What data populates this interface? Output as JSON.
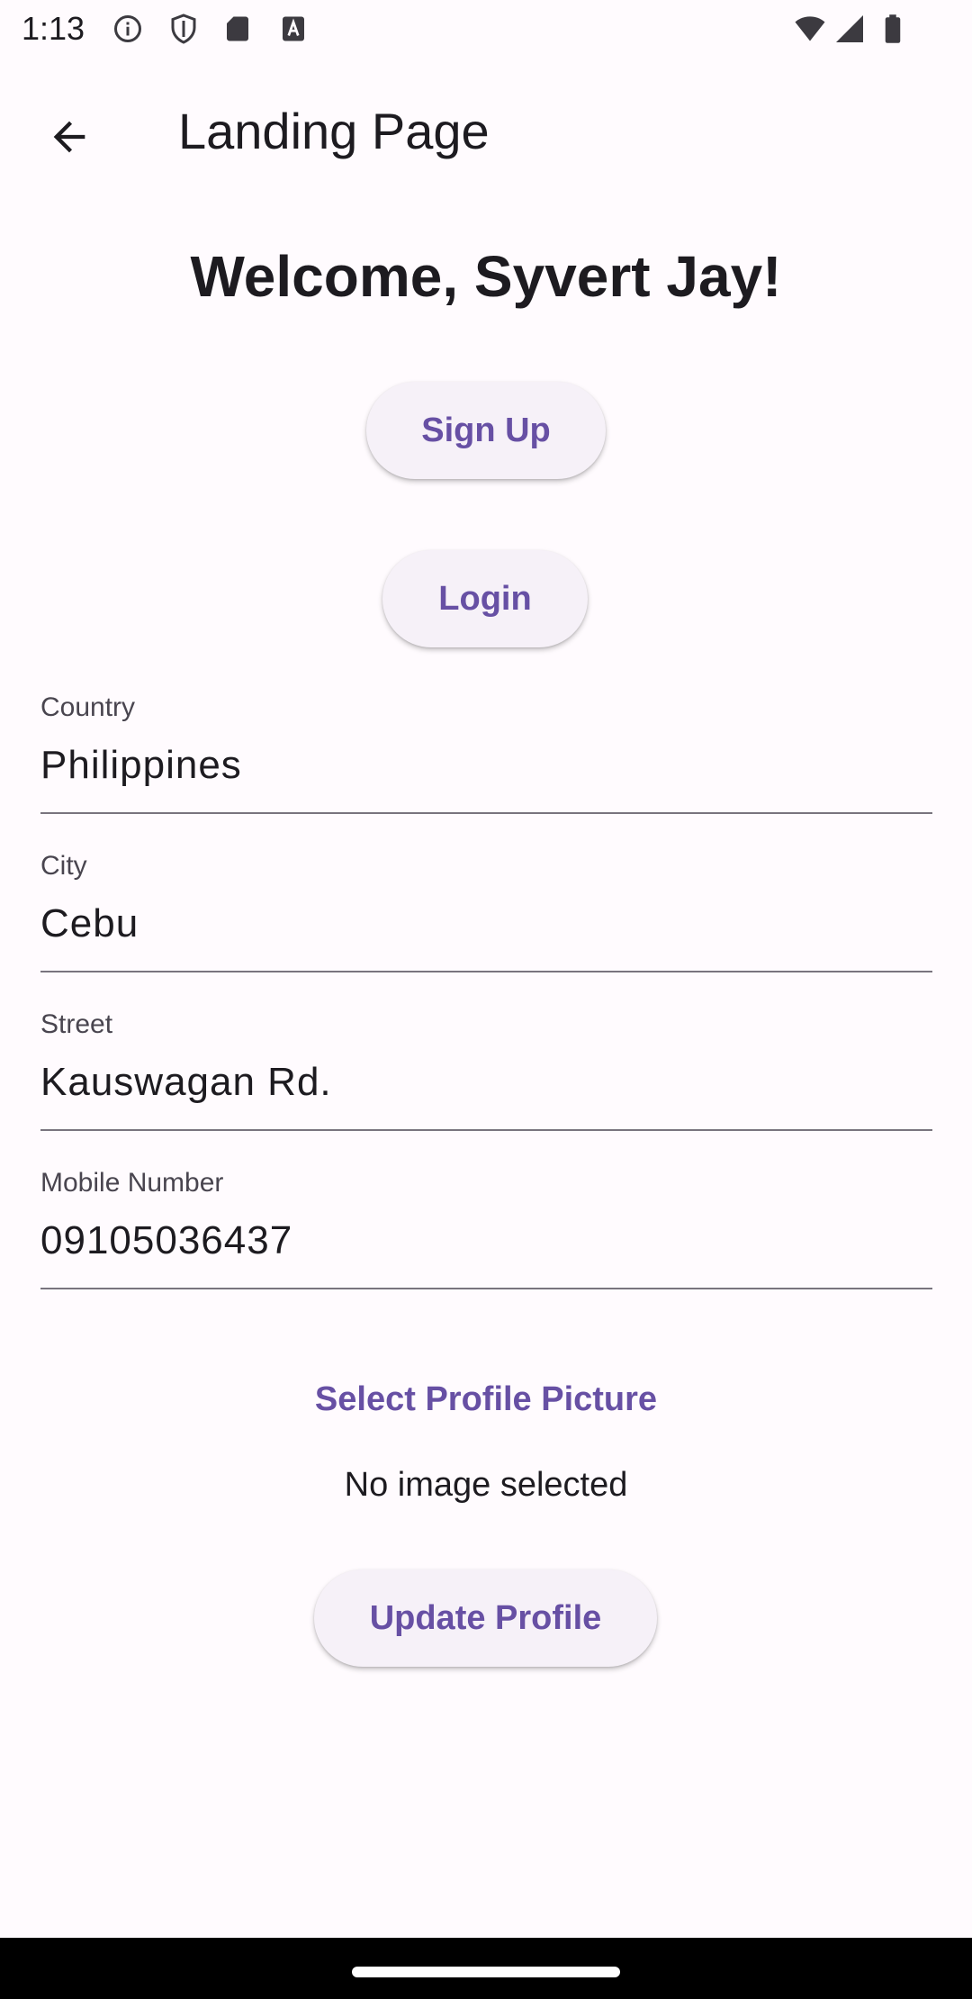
{
  "status_bar": {
    "time": "1:13",
    "icons": [
      "info-icon",
      "shield-icon",
      "sd-card-icon",
      "font-a-icon",
      "wifi-icon",
      "signal-icon",
      "battery-icon"
    ]
  },
  "app_bar": {
    "title": "Landing Page",
    "back_icon": "arrow-back-icon"
  },
  "welcome": {
    "text": "Welcome, Syvert Jay!"
  },
  "buttons": {
    "sign_up": "Sign Up",
    "login": "Login",
    "select_profile_picture": "Select Profile Picture",
    "update_profile": "Update Profile"
  },
  "fields": [
    {
      "label": "Country",
      "value": "Philippines"
    },
    {
      "label": "City",
      "value": "Cebu"
    },
    {
      "label": "Street",
      "value": "Kauswagan Rd."
    },
    {
      "label": "Mobile Number",
      "value": "09105036437"
    }
  ],
  "image_status": "No image selected",
  "colors": {
    "accent": "#6750a4",
    "background": "#fffbfe",
    "button_surface": "#f6f1f8",
    "text": "#1d1b20",
    "divider": "#79747e"
  }
}
